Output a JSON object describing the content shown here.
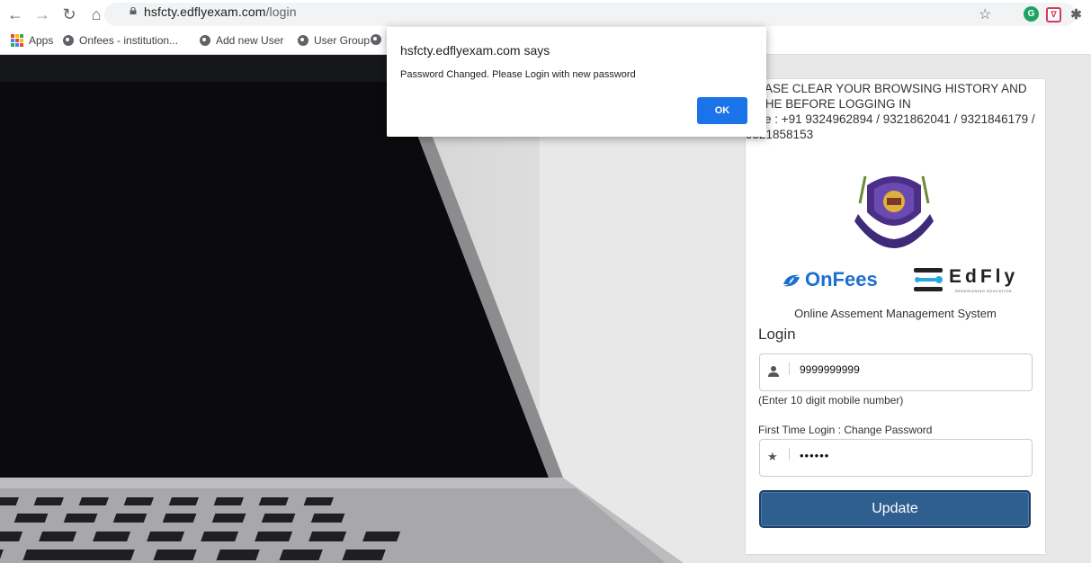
{
  "browser": {
    "url_host": "hsfcty.edflyexam.com",
    "url_path": "/login",
    "bookmarks": [
      {
        "label": "Apps"
      },
      {
        "label": "Onfees - institution..."
      },
      {
        "label": "Add new User"
      },
      {
        "label": "User Group"
      }
    ]
  },
  "dialog": {
    "title": "hsfcty.edflyexam.com says",
    "message": "Password Changed. Please Login with new password",
    "ok_label": "OK"
  },
  "panel": {
    "notice_line1": "EASE CLEAR YOUR BROWSING HISTORY AND",
    "notice_line2": "CHE BEFORE LOGGING IN",
    "notice_line3": "pline : +91 9324962894 / 9321862041 / 9321846179 / 9321858153",
    "brand_onfees": "OnFees",
    "brand_edfly": "EdFly",
    "brand_edfly_tagline": "REDESIGNING EDUCATION",
    "subtitle": "Online Assement Management System",
    "login_heading": "Login",
    "mobile_value": "9999999999",
    "mobile_hint": "(Enter 10 digit mobile number)",
    "password_label": "First Time Login : Change Password",
    "password_value": "••••••",
    "update_label": "Update"
  },
  "icons": {
    "back": "arrow-left-icon",
    "forward": "arrow-right-icon",
    "reload": "reload-icon",
    "home": "home-icon",
    "lock": "lock-icon",
    "star": "star-icon",
    "user": "user-icon",
    "password": "star-field-icon"
  },
  "colors": {
    "button_primary": "#2e5f8f",
    "dialog_ok": "#1a73e8",
    "onfees_blue": "#1a6fd0"
  }
}
